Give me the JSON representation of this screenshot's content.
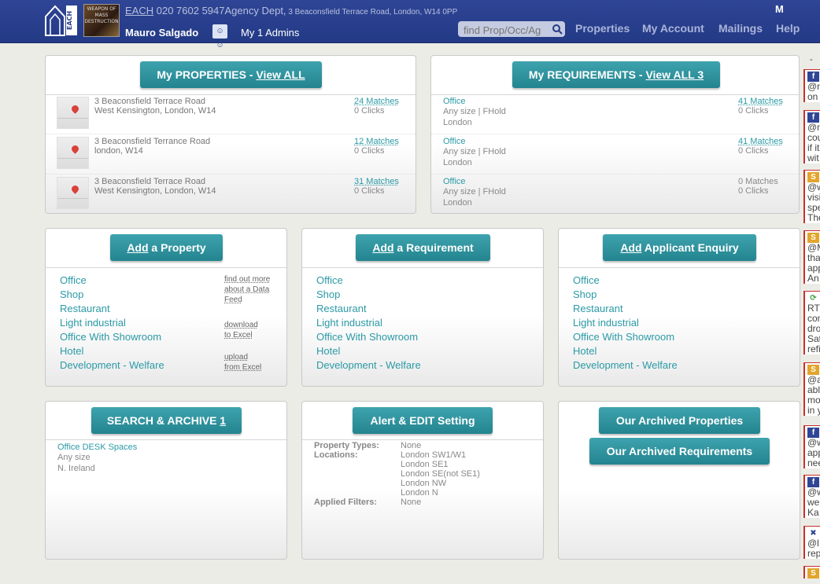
{
  "header": {
    "each": "EACH",
    "phone": " 020 7602 5947",
    "dept": "Agency Dept,",
    "address": " 3 Beaconsfield Terrace Road, London, W14 0PP",
    "user": "Mauro Salgado",
    "admins": "My 1 Admins",
    "search_placeholder": "find Prop/Occ/Ag",
    "nav": [
      "Properties",
      "My Account",
      "Mailings",
      "Help"
    ],
    "m_letter": "M",
    "logo_text": "EACH",
    "poster_text": "WEAPON OF MASS DESTRUCTION"
  },
  "properties": {
    "title": "My PROPERTIES - ",
    "view_all": "View ALL",
    "rows": [
      {
        "addr1": "3 Beaconsfield Terrace Road",
        "addr2": "West Kensington, London, W14",
        "matches": "24 Matches",
        "clicks": "0 Clicks"
      },
      {
        "addr1": "3 Beaconsfield Terrance Road",
        "addr2": "london, W14",
        "matches": "12 Matches",
        "clicks": "0 Clicks"
      },
      {
        "addr1": "3 Beaconsfield Terrace Road",
        "addr2": "West Kensington, London, W14",
        "matches": "31 Matches",
        "clicks": "0 Clicks"
      }
    ]
  },
  "requirements": {
    "title": "My REQUIREMENTS - ",
    "view_all": "View ALL 3",
    "rows": [
      {
        "type": "Office",
        "size": "Any size | FHold",
        "loc": "London",
        "matches": "41 Matches",
        "clicks": "0 Clicks"
      },
      {
        "type": "Office",
        "size": "Any size | FHold",
        "loc": "London",
        "matches": "41 Matches",
        "clicks": "0 Clicks"
      },
      {
        "type": "Office",
        "size": "Any size | FHold",
        "loc": "London",
        "matches": "0 Matches",
        "clicks": "0 Clicks"
      }
    ]
  },
  "add_property": {
    "add": "Add",
    "rest": " a Property"
  },
  "add_requirement": {
    "add": "Add",
    "rest": " a Requirement"
  },
  "add_enquiry": {
    "add": "Add",
    "rest": " Applicant Enquiry"
  },
  "types": [
    "Office",
    "Shop",
    "Restaurant",
    "Light industrial",
    "Office With Showroom",
    "Hotel",
    "Development - Welfare"
  ],
  "side_links": {
    "find_out": [
      "find out more",
      "about a Data",
      "Feed"
    ],
    "download": [
      "download",
      "to Excel"
    ],
    "upload": [
      "upload",
      "from Excel"
    ]
  },
  "search_archive": {
    "label": "SEARCH & ARCHIVE ",
    "count": "1",
    "saved_type": "Office DESK Spaces",
    "saved_size": "Any size",
    "saved_loc": "N. Ireland"
  },
  "alert": {
    "label": "Alert & EDIT Setting",
    "property_types_label": "Property Types:",
    "property_types_value": "None",
    "locations_label": "Locations:",
    "locations": [
      "London SW1/W1",
      "London SE1",
      "London SE(not SE1)",
      "London NW",
      "London N"
    ],
    "filters_label": "Applied Filters:",
    "filters_value": "None"
  },
  "archived": {
    "properties": "Our Archived Properties",
    "requirements": "Our Archived Requirements"
  },
  "feed": {
    "dash": "-",
    "items": [
      {
        "icon": "fb",
        "lines": [
          "@n",
          "on"
        ]
      },
      {
        "icon": "fb",
        "lines": [
          "@n",
          "cou",
          "if it",
          "wit"
        ]
      },
      {
        "icon": "so",
        "lines": [
          "@w",
          "visi",
          "spe",
          "The"
        ]
      },
      {
        "icon": "so",
        "lines": [
          "@M",
          "tha",
          "app",
          "An"
        ]
      },
      {
        "icon": "rt",
        "lines": [
          "RT",
          "com",
          "dro",
          "Sat",
          "refi"
        ]
      },
      {
        "icon": "so",
        "lines": [
          "@a",
          "abl",
          "mo",
          "in y"
        ]
      },
      {
        "icon": "fb",
        "lines": [
          "@w",
          "app",
          "nee"
        ]
      },
      {
        "icon": "fb",
        "lines": [
          "@w",
          "we",
          "Ka"
        ]
      },
      {
        "icon": "uk",
        "lines": [
          "@l",
          "rep"
        ]
      },
      {
        "icon": "so",
        "lines": []
      }
    ]
  }
}
